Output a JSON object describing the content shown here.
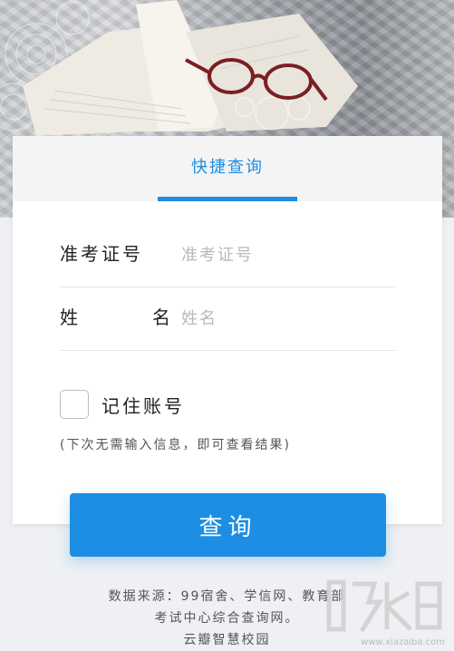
{
  "tab": {
    "label": "快捷查询"
  },
  "form": {
    "exam_no_label": "准考证号",
    "exam_no_placeholder": "准考证号",
    "name_label_left": "姓",
    "name_label_right": "名",
    "name_placeholder": "姓名",
    "remember_label": "记住账号",
    "remember_checked": false,
    "hint": "(下次无需输入信息，即可查看结果)"
  },
  "query_button": {
    "label": "查询"
  },
  "footer": {
    "line1": "数据来源：99宿舍、学信网、教育部",
    "line2": "考试中心综合查询网。",
    "line3": "云瓣智慧校园"
  },
  "watermark": {
    "url": "www.xiazaiba.com"
  },
  "colors": {
    "accent": "#1d8ee3",
    "tab_bg": "#f4f4f4",
    "page_bg": "#eef0f3"
  }
}
